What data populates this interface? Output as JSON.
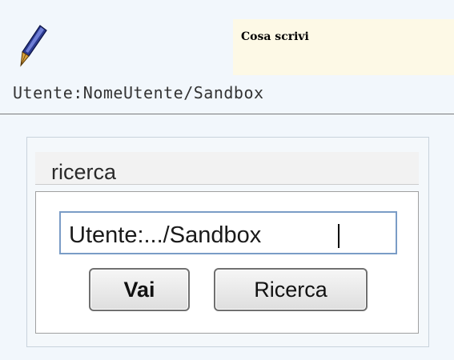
{
  "hint": {
    "title": "Cosa scrivi",
    "icon": "fountain-pen-icon"
  },
  "example_path": "Utente:NomeUtente/Sandbox",
  "search_panel": {
    "title": "ricerca",
    "input_value": "Utente:.../Sandbox",
    "go_button_label": "Vai",
    "search_button_label": "Ricerca"
  }
}
